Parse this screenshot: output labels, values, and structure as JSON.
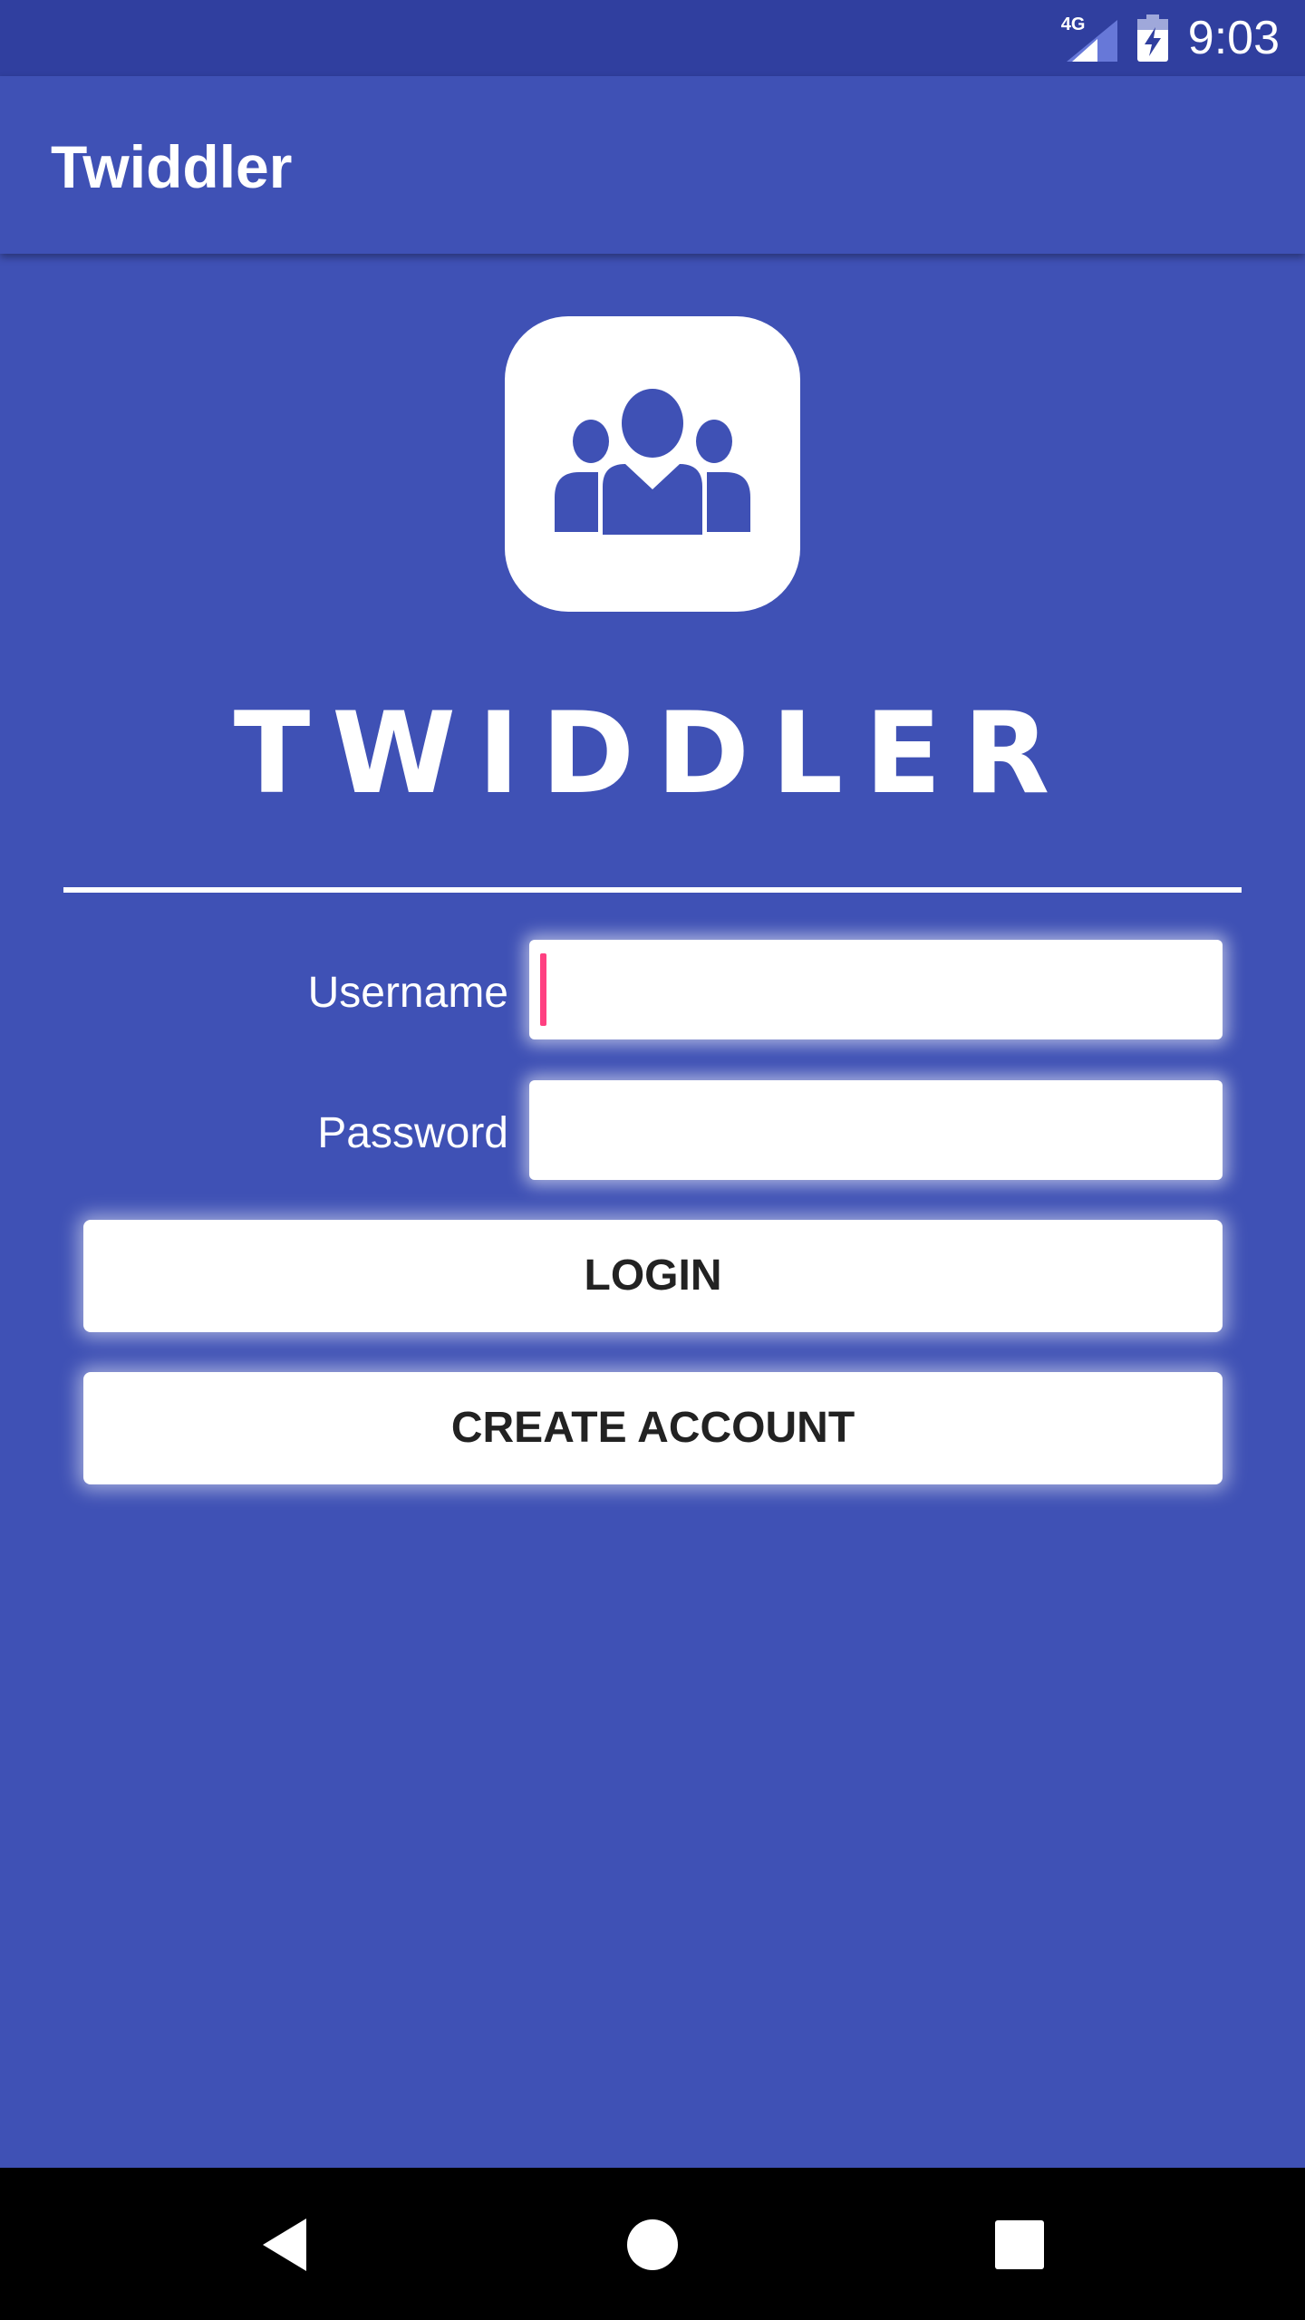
{
  "status_bar": {
    "network": "4G",
    "time": "9:03"
  },
  "app_bar": {
    "title": "Twiddler"
  },
  "brand": {
    "wordmark": "TWIDDLER",
    "logo_icon": "people-group-icon"
  },
  "form": {
    "username_label": "Username",
    "username_value": "",
    "password_label": "Password",
    "password_value": ""
  },
  "buttons": {
    "login": "LOGIN",
    "create_account": "CREATE ACCOUNT"
  },
  "colors": {
    "primary": "#3f51b5",
    "primary_dark": "#303f9f",
    "accent": "#ff4081"
  },
  "nav_bar": {
    "icons": [
      "back-icon",
      "home-icon",
      "recents-icon"
    ]
  }
}
